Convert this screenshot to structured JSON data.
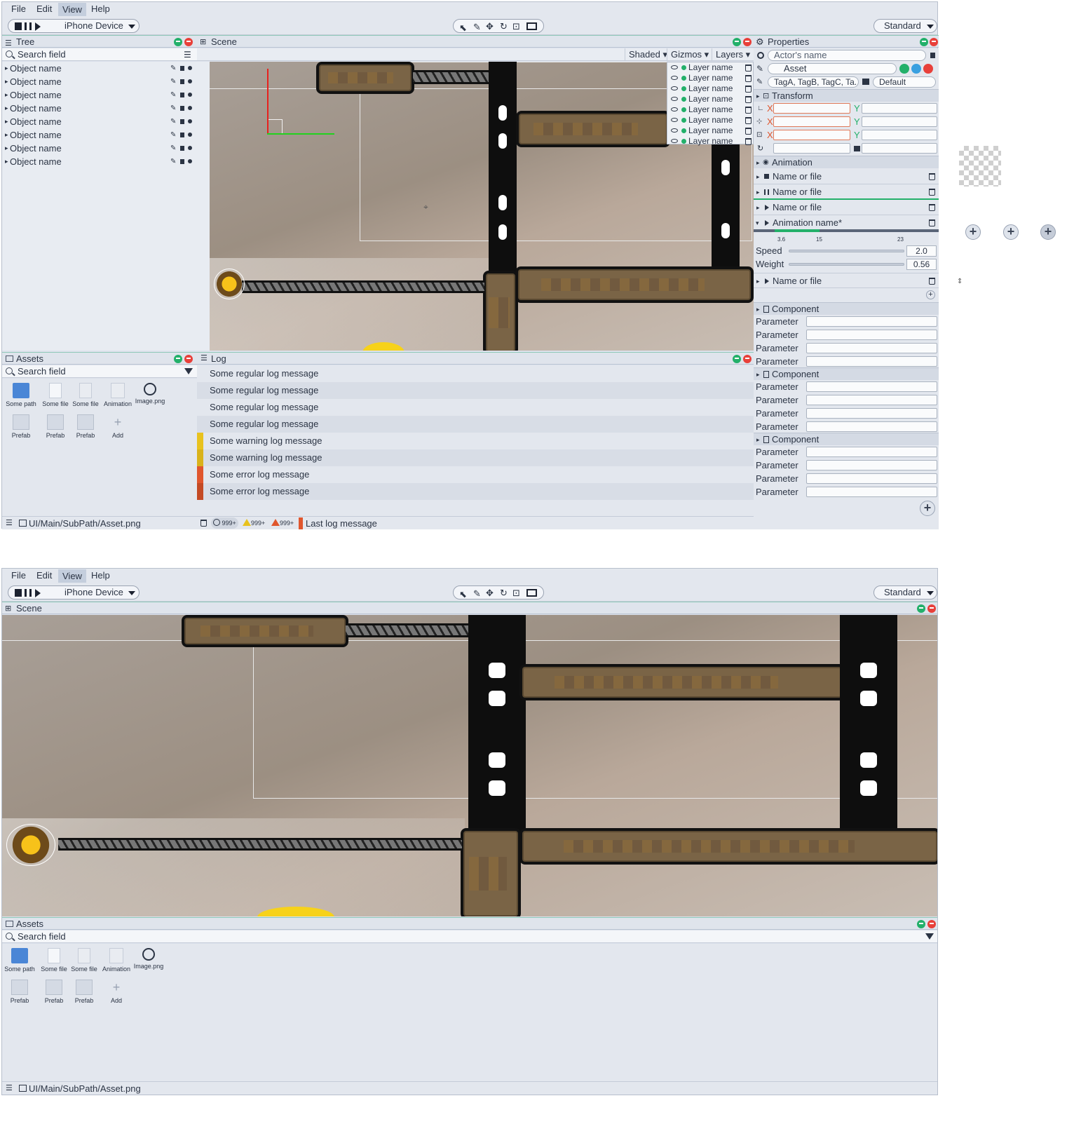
{
  "menu": {
    "items": [
      "File",
      "Edit",
      "View",
      "Help"
    ],
    "active": "View"
  },
  "toolbar": {
    "device": "iPhone Device",
    "layout": "Standard"
  },
  "tree": {
    "title": "Tree",
    "search_placeholder": "Search field",
    "items": [
      "Object name",
      "Object name",
      "Object name",
      "Object name",
      "Object name",
      "Object name",
      "Object name",
      "Object name"
    ]
  },
  "scene": {
    "title": "Scene",
    "shaded": "Shaded",
    "gizmos": "Gizmos",
    "layers": "Layers",
    "layer_items": [
      "Layer name",
      "Layer name",
      "Layer name",
      "Layer name",
      "Layer name",
      "Layer name",
      "Layer name",
      "Layer name"
    ]
  },
  "properties": {
    "title": "Properties",
    "actor_name_placeholder": "Actor's name",
    "asset": "Asset",
    "tags": "TagA, TagB, TagC, Ta...",
    "layer_default": "Default",
    "transform": "Transform",
    "axis_x": "X",
    "axis_y": "Y",
    "animation": "Animation",
    "anim_items": [
      "Name or file",
      "Name or file",
      "Name or file"
    ],
    "anim_expanded": "Animation name*",
    "timeline_ticks": [
      "3.6",
      "15",
      "23"
    ],
    "speed_label": "Speed",
    "speed_value": "2.0",
    "weight_label": "Weight",
    "weight_value": "0.56",
    "anim_last": "Name or file",
    "component": "Component",
    "parameter": "Parameter",
    "components": [
      {
        "title": "Component",
        "params": [
          "Parameter",
          "Parameter",
          "Parameter",
          "Parameter"
        ]
      },
      {
        "title": "Component",
        "params": [
          "Parameter",
          "Parameter",
          "Parameter",
          "Parameter"
        ]
      },
      {
        "title": "Component",
        "params": [
          "Parameter",
          "Parameter",
          "Parameter",
          "Parameter"
        ]
      }
    ]
  },
  "assets": {
    "title": "Assets",
    "search_placeholder": "Search field",
    "items": [
      {
        "label": "Some path",
        "icon": "folder-icon"
      },
      {
        "label": "Some file",
        "icon": "file-icon"
      },
      {
        "label": "Some file",
        "icon": "text-file-icon"
      },
      {
        "label": "Animation",
        "icon": "animation-icon"
      },
      {
        "label": "Image.png",
        "icon": "image-icon"
      }
    ],
    "items2": [
      {
        "label": "Prefab",
        "icon": "prefab-icon"
      },
      {
        "label": "Prefab",
        "icon": "prefab-icon"
      },
      {
        "label": "Prefab",
        "icon": "prefab-icon"
      },
      {
        "label": "Add",
        "icon": "add-icon"
      }
    ],
    "path": "UI/Main/SubPath/Asset.png"
  },
  "log": {
    "title": "Log",
    "messages": [
      {
        "text": "Some regular log message",
        "level": "regular"
      },
      {
        "text": "Some regular log message",
        "level": "regular"
      },
      {
        "text": "Some regular log message",
        "level": "regular"
      },
      {
        "text": "Some regular log message",
        "level": "regular"
      },
      {
        "text": "Some warning log message",
        "level": "warning"
      },
      {
        "text": "Some warning log message",
        "level": "warning"
      },
      {
        "text": "Some error log message",
        "level": "error"
      },
      {
        "text": "Some error log message",
        "level": "error"
      }
    ],
    "count_info": "999+",
    "count_warn": "999+",
    "count_err": "999+",
    "last": "Last log message"
  },
  "colors": {
    "accent_green": "#23b06a",
    "close_red": "#e8403a",
    "warning": "#e8c21e",
    "error": "#e0562d"
  }
}
